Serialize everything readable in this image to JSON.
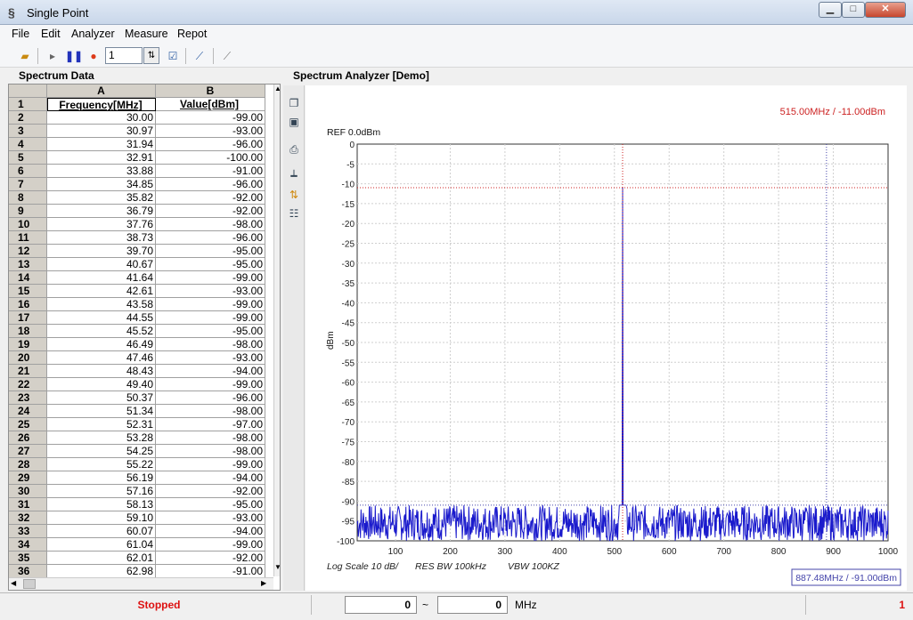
{
  "window": {
    "title": "Single Point"
  },
  "menu": [
    "File",
    "Edit",
    "Analyzer",
    "Measure",
    "Repot"
  ],
  "toolbar": {
    "count_value": "1"
  },
  "left_panel": {
    "title": "Spectrum Data"
  },
  "right_panel": {
    "title": "Spectrum Analyzer [Demo]"
  },
  "grid": {
    "col_a": "A",
    "col_b": "B",
    "header_row": {
      "n": "1",
      "a": "Frequency[MHz]",
      "b": "Value[dBm]"
    },
    "rows": [
      [
        "2",
        "30.00",
        "-99.00"
      ],
      [
        "3",
        "30.97",
        "-93.00"
      ],
      [
        "4",
        "31.94",
        "-96.00"
      ],
      [
        "5",
        "32.91",
        "-100.00"
      ],
      [
        "6",
        "33.88",
        "-91.00"
      ],
      [
        "7",
        "34.85",
        "-96.00"
      ],
      [
        "8",
        "35.82",
        "-92.00"
      ],
      [
        "9",
        "36.79",
        "-92.00"
      ],
      [
        "10",
        "37.76",
        "-98.00"
      ],
      [
        "11",
        "38.73",
        "-96.00"
      ],
      [
        "12",
        "39.70",
        "-95.00"
      ],
      [
        "13",
        "40.67",
        "-95.00"
      ],
      [
        "14",
        "41.64",
        "-99.00"
      ],
      [
        "15",
        "42.61",
        "-93.00"
      ],
      [
        "16",
        "43.58",
        "-99.00"
      ],
      [
        "17",
        "44.55",
        "-99.00"
      ],
      [
        "18",
        "45.52",
        "-95.00"
      ],
      [
        "19",
        "46.49",
        "-98.00"
      ],
      [
        "20",
        "47.46",
        "-93.00"
      ],
      [
        "21",
        "48.43",
        "-94.00"
      ],
      [
        "22",
        "49.40",
        "-99.00"
      ],
      [
        "23",
        "50.37",
        "-96.00"
      ],
      [
        "24",
        "51.34",
        "-98.00"
      ],
      [
        "25",
        "52.31",
        "-97.00"
      ],
      [
        "26",
        "53.28",
        "-98.00"
      ],
      [
        "27",
        "54.25",
        "-98.00"
      ],
      [
        "28",
        "55.22",
        "-99.00"
      ],
      [
        "29",
        "56.19",
        "-94.00"
      ],
      [
        "30",
        "57.16",
        "-92.00"
      ],
      [
        "31",
        "58.13",
        "-95.00"
      ],
      [
        "32",
        "59.10",
        "-93.00"
      ],
      [
        "33",
        "60.07",
        "-94.00"
      ],
      [
        "34",
        "61.04",
        "-99.00"
      ],
      [
        "35",
        "62.01",
        "-92.00"
      ],
      [
        "36",
        "62.98",
        "-91.00"
      ]
    ]
  },
  "chart": {
    "ref_label": "REF 0.0dBm",
    "ylabel": "dBm",
    "marker1_readout": "515.00MHz / -11.00dBm",
    "marker2_readout": "887.48MHz / -91.00dBm",
    "footer": {
      "scale": "Log Scale 10 dB/",
      "res_bw": "RES BW 100kHz",
      "vbw": "VBW 100KZ"
    },
    "colors": {
      "trace": "#1a1acc",
      "marker1": "#cc2222",
      "marker2": "#4444aa"
    }
  },
  "chart_data": {
    "type": "line",
    "xlim": [
      30,
      1000
    ],
    "ylim": [
      -100,
      0
    ],
    "x_ticks": [
      100,
      200,
      300,
      400,
      500,
      600,
      700,
      800,
      900,
      1000
    ],
    "y_ticks": [
      0,
      -5,
      -10,
      -15,
      -20,
      -25,
      -30,
      -35,
      -40,
      -45,
      -50,
      -55,
      -60,
      -65,
      -70,
      -75,
      -80,
      -85,
      -90,
      -95,
      -100
    ],
    "grid": true,
    "peak": {
      "x": 515,
      "y": -11
    },
    "noise_floor_range": [
      -100,
      -91
    ],
    "markers": [
      {
        "x": 515,
        "y": -11
      },
      {
        "x": 887.48,
        "y": -91
      }
    ]
  },
  "status": {
    "state": "Stopped",
    "range_from": "0",
    "tilde": "~",
    "range_to": "0",
    "unit": "MHz",
    "count": "1"
  }
}
